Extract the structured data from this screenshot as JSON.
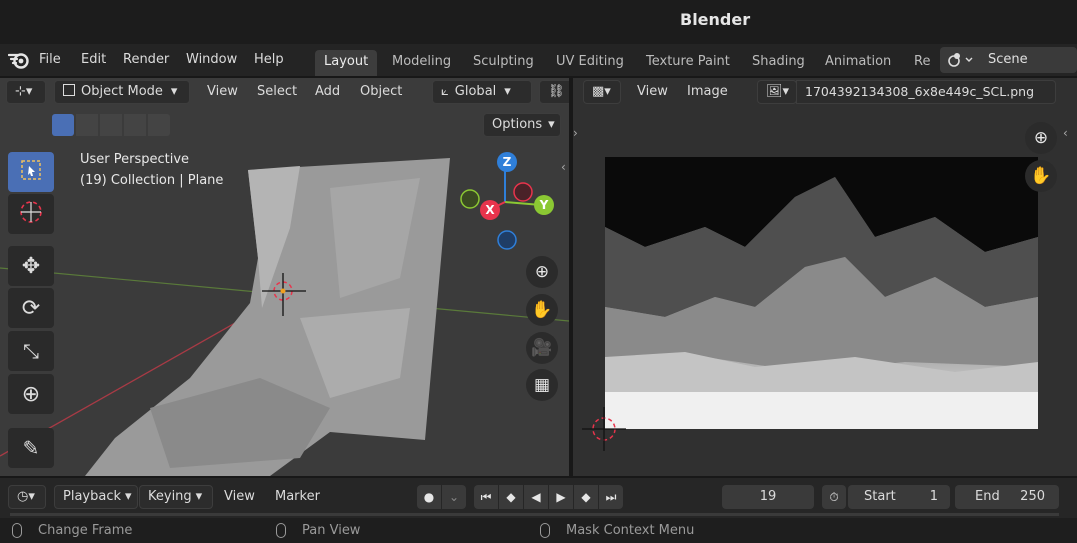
{
  "window": {
    "title": "Blender"
  },
  "menu": [
    "File",
    "Edit",
    "Render",
    "Window",
    "Help"
  ],
  "workspaces": [
    "Layout",
    "Modeling",
    "Sculpting",
    "UV Editing",
    "Texture Paint",
    "Shading",
    "Animation",
    "Re"
  ],
  "active_workspace": "Layout",
  "scene": {
    "label": "Scene"
  },
  "viewport": {
    "mode": "Object Mode",
    "menus": [
      "View",
      "Select",
      "Add",
      "Object"
    ],
    "transform_orientation": "Global",
    "options_label": "Options",
    "overlay_line1": "User Perspective",
    "overlay_line2": "(19) Collection | Plane",
    "gizmo_axes": {
      "z": "Z",
      "x": "X",
      "y": "Y"
    },
    "tools": [
      "select-box-icon",
      "cursor-icon",
      "move-icon",
      "rotate-icon",
      "scale-icon",
      "transform-icon",
      "annotate-icon"
    ]
  },
  "image_editor": {
    "menus": [
      "View",
      "Image"
    ],
    "image_name": "1704392134308_6x8e449c_SCL.png"
  },
  "timeline": {
    "playback_label": "Playback",
    "keying_label": "Keying",
    "view_label": "View",
    "marker_label": "Marker",
    "current_frame": "19",
    "start_label": "Start",
    "start_value": "1",
    "end_label": "End",
    "end_value": "250"
  },
  "statusbar": {
    "left": "Change Frame",
    "middle": "Pan View",
    "right": "Mask Context Menu"
  },
  "colors": {
    "accent": "#4a6fb5",
    "axis_x": "#e8344c",
    "axis_y": "#8bc833",
    "axis_z": "#2f7fd9"
  }
}
